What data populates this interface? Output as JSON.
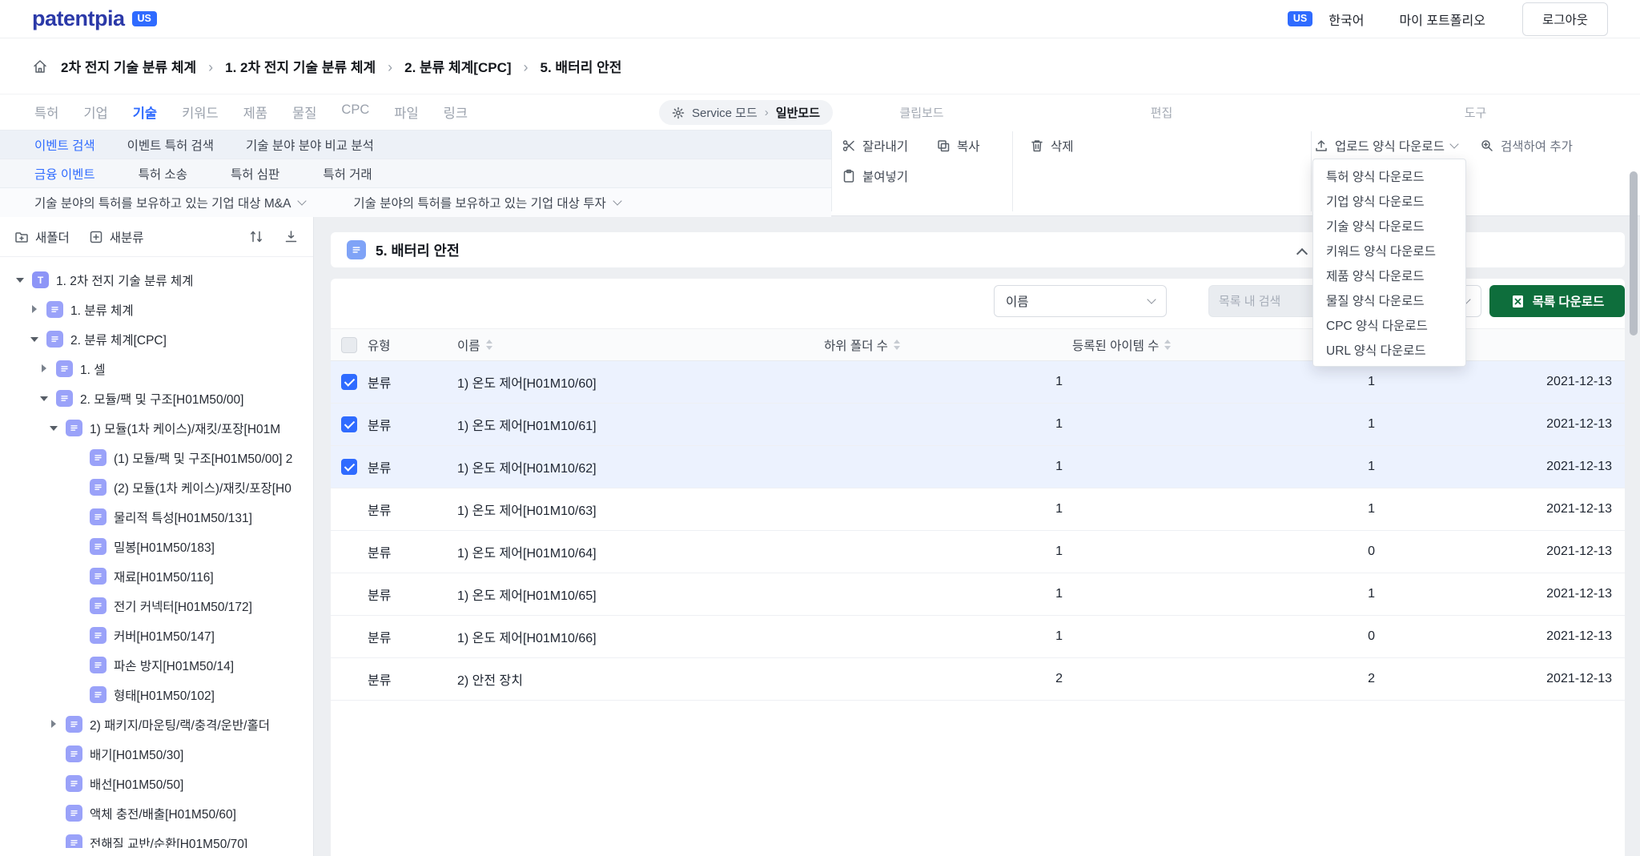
{
  "topbar": {
    "logo": "patentpia",
    "logo_badge": "US",
    "country_badge": "US",
    "language": "한국어",
    "my_portfolio": "마이 포트폴리오",
    "logout": "로그아웃"
  },
  "breadcrumb": {
    "items": [
      {
        "label": "2차 전지 기술 분류 체계"
      },
      {
        "label": "1. 2차 전지 기술 분류 체계"
      },
      {
        "label": "2. 분류 체계[CPC]"
      },
      {
        "label": "5. 배터리 안전"
      }
    ]
  },
  "ribbon": {
    "tabs": [
      {
        "label": "특허",
        "active": "false"
      },
      {
        "label": "기업",
        "active": "false"
      },
      {
        "label": "기술",
        "active": "true"
      },
      {
        "label": "키워드",
        "active": "false"
      },
      {
        "label": "제품",
        "active": "false"
      },
      {
        "label": "물질",
        "active": "false"
      },
      {
        "label": "CPC",
        "active": "false"
      },
      {
        "label": "파일",
        "active": "false"
      },
      {
        "label": "링크",
        "active": "false"
      }
    ],
    "service_mode_label": "Service 모드",
    "mode_value": "일반모드",
    "event_row": [
      {
        "label": "이벤트 검색",
        "active": "true"
      },
      {
        "label": "이벤트 특허 검색",
        "active": "false"
      },
      {
        "label": "기술 분야 분야 비교 분석",
        "active": "false"
      }
    ],
    "finance_row": [
      {
        "label": "금융 이벤트",
        "active": "true"
      },
      {
        "label": "특허 소송",
        "active": "false"
      },
      {
        "label": "특허 심판",
        "active": "false"
      },
      {
        "label": "특허 거래",
        "active": "false"
      }
    ],
    "scope_row": [
      {
        "label": "기술 분야의 특허를 보유하고 있는 기업 대상 M&A"
      },
      {
        "label": "기술 분야의 특허를 보유하고 있는 기업 대상 투자"
      }
    ],
    "groups": {
      "clipboard": {
        "title": "클립보드",
        "cut": "잘라내기",
        "copy": "복사",
        "paste": "붙여넣기"
      },
      "edit": {
        "title": "편집",
        "delete": "삭제"
      },
      "tools": {
        "title": "도구",
        "upload_template": "업로드 양식 다운로드",
        "search_add": "검색하여 추가"
      }
    }
  },
  "upload_menu": {
    "items": [
      "특허 양식 다운로드",
      "기업 양식 다운로드",
      "기술 양식 다운로드",
      "키워드 양식 다운로드",
      "제품 양식 다운로드",
      "물질 양식 다운로드",
      "CPC 양식 다운로드",
      "URL 양식 다운로드"
    ]
  },
  "sidebar": {
    "new_folder": "새폴더",
    "new_category": "새분류",
    "tree": [
      {
        "level": "0",
        "expand": "open",
        "badge": "T",
        "label": "1. 2차 전지 기술 분류 체계"
      },
      {
        "level": "1",
        "expand": "closed",
        "badge": "",
        "label": "1. 분류 체계"
      },
      {
        "level": "1",
        "expand": "open",
        "badge": "",
        "label": "2. 분류 체계[CPC]"
      },
      {
        "level": "2",
        "expand": "closed",
        "badge": "",
        "label": "1. 셀"
      },
      {
        "level": "2",
        "expand": "open",
        "badge": "",
        "label": "2. 모듈/팩 및 구조[H01M50/00]"
      },
      {
        "level": "3",
        "expand": "open",
        "badge": "",
        "label": "1) 모듈(1차 케이스)/재킷/포장[H01M"
      },
      {
        "level": "4",
        "expand": "none",
        "badge": "",
        "label": "(1) 모듈/팩 및 구조[H01M50/00] 2"
      },
      {
        "level": "4",
        "expand": "none",
        "badge": "",
        "label": "(2) 모듈(1차 케이스)/재킷/포장[H0"
      },
      {
        "level": "4",
        "expand": "none",
        "badge": "",
        "label": "물리적 특성[H01M50/131]"
      },
      {
        "level": "4",
        "expand": "none",
        "badge": "",
        "label": "밀봉[H01M50/183]"
      },
      {
        "level": "4",
        "expand": "none",
        "badge": "",
        "label": "재료[H01M50/116]"
      },
      {
        "level": "4",
        "expand": "none",
        "badge": "",
        "label": "전기 커넥터[H01M50/172]"
      },
      {
        "level": "4",
        "expand": "none",
        "badge": "",
        "label": "커버[H01M50/147]"
      },
      {
        "level": "4",
        "expand": "none",
        "badge": "",
        "label": "파손 방지[H01M50/14]"
      },
      {
        "level": "4",
        "expand": "none",
        "badge": "",
        "label": "형태[H01M50/102]"
      },
      {
        "level": "3",
        "expand": "closed",
        "badge": "",
        "label": "2) 패키지/마운팅/랙/충격/운반/홀더"
      },
      {
        "level": "3",
        "expand": "none",
        "badge": "",
        "label": "배기[H01M50/30]"
      },
      {
        "level": "3",
        "expand": "none",
        "badge": "",
        "label": "배선[H01M50/50]"
      },
      {
        "level": "3",
        "expand": "none",
        "badge": "",
        "label": "액체 충전/배출[H01M50/60]"
      },
      {
        "level": "3",
        "expand": "none",
        "badge": "",
        "label": "전해질 교반/순환[H01M50/70]"
      }
    ]
  },
  "panel": {
    "title": "5. 배터리 안전"
  },
  "filter": {
    "name_option": "이름",
    "search_placeholder": "목록 내 검색",
    "download_button": "목록 다운로드"
  },
  "table": {
    "columns": [
      {
        "label": "유형"
      },
      {
        "label": "이름"
      },
      {
        "label": "하위 폴더 수"
      },
      {
        "label": "등록된 아이템 수"
      },
      {
        "label": ""
      }
    ],
    "rows": [
      {
        "checked": "true",
        "type": "분류",
        "name": "1) 온도 제어[H01M10/60]",
        "subfolders": "1",
        "items": "1",
        "date": "2021-12-13"
      },
      {
        "checked": "true",
        "type": "분류",
        "name": "1) 온도 제어[H01M10/61]",
        "subfolders": "1",
        "items": "1",
        "date": "2021-12-13"
      },
      {
        "checked": "true",
        "type": "분류",
        "name": "1) 온도 제어[H01M10/62]",
        "subfolders": "1",
        "items": "1",
        "date": "2021-12-13"
      },
      {
        "checked": "false",
        "type": "분류",
        "name": "1) 온도 제어[H01M10/63]",
        "subfolders": "1",
        "items": "1",
        "date": "2021-12-13"
      },
      {
        "checked": "false",
        "type": "분류",
        "name": "1) 온도 제어[H01M10/64]",
        "subfolders": "1",
        "items": "0",
        "date": "2021-12-13"
      },
      {
        "checked": "false",
        "type": "분류",
        "name": "1) 온도 제어[H01M10/65]",
        "subfolders": "1",
        "items": "1",
        "date": "2021-12-13"
      },
      {
        "checked": "false",
        "type": "분류",
        "name": "1) 온도 제어[H01M10/66]",
        "subfolders": "1",
        "items": "0",
        "date": "2021-12-13"
      },
      {
        "checked": "false",
        "type": "분류",
        "name": "2) 안전 장치",
        "subfolders": "2",
        "items": "2",
        "date": "2021-12-13"
      }
    ]
  }
}
